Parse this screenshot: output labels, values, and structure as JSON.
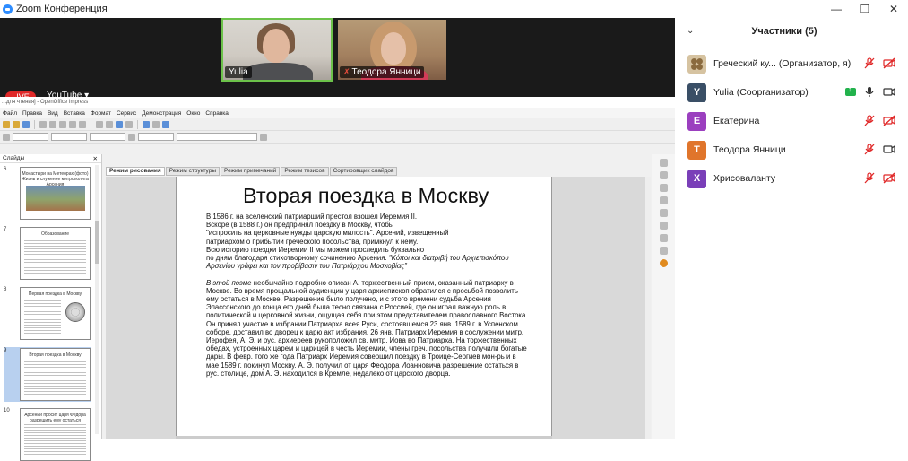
{
  "app": {
    "title": "Zoom Конференция"
  },
  "window_controls": {
    "minimize": "—",
    "restore": "❐",
    "close": "✕"
  },
  "videos": [
    {
      "name": "Yulia"
    },
    {
      "name": "Теодора Янници"
    }
  ],
  "stream": {
    "live_label": "LIVE",
    "platform_label": "YouTube"
  },
  "openoffice": {
    "title": "...для чтения] - OpenOffice Impress",
    "menu": [
      "Файл",
      "Правка",
      "Вид",
      "Вставка",
      "Формат",
      "Сервис",
      "Демонстрация",
      "Окно",
      "Справка"
    ],
    "slides_panel_label": "Слайды",
    "tabs": [
      "Режим рисования",
      "Режим структуры",
      "Режим примечаний",
      "Режим тезисов",
      "Сортировщик слайдов"
    ],
    "thumbnails": [
      {
        "num": "6",
        "title": "Монастыри на Метеорах (фото) Жизнь и служение митрополита Арсения"
      },
      {
        "num": "7",
        "title": "Образование"
      },
      {
        "num": "8",
        "title": "Первая поездка в Москву"
      },
      {
        "num": "9",
        "title": "Вторая поездка в Москву"
      },
      {
        "num": "10",
        "title": "Арсений просит царя Федора разрешить ему остаться"
      }
    ],
    "slide": {
      "title": "Вторая поездка в Москву",
      "para1": " В 1586 г. на вселенский патриарший престол взошел Иеремия II.\nВскоре (в 1588 г.) он предпринял поездку в Москву, чтобы\n\"испросить на церковные нужды царскую милость\". Арсений, извещенный\nпатриархом о прибытии греческого посольства, примкнул к нему.\nВсю историю поездки Иеремии II мы можем проследить буквально\nпо дням благодаря стихотворному сочинению Арсения.",
      "greek": " \"Κόποι και διατριβή του Αρχιεπισκόπου Αρσενίου γράφει και τον προβίβασιν του Πατριάρχου Μοσκοβίας\"",
      "para2_italic": " В этой поэме",
      "para2": " необычайно подробно описан А. торжественный прием, оказанный патриарху в Москве. Во время прощальной аудиенции у царя архиепископ обратился с просьбой позволить ему остаться в Москве. Разрешение было получено, и с этого времени судьба Арсения Элассонского до конца его дней была тесно связана с Россией, где он играл важную роль в политической и церковной жизни, ощущая себя при этом представителем православного Востока.\nОн принял участие в избрании Патриарха всея Руси, состоявшемся 23 янв. 1589 г. в Успенском соборе, доставил во дворец к царю акт избрания. 26 янв. Патриарх Иеремия в сослужении митр. Иерофея, А. Э. и рус. архиереев рукоположил св. митр. Иова во Патриарха. На торжественных обедах, устроенных царем и царицей в честь Иеремии, члены греч. посольства получили богатые дары. В февр. того же года Патриарх Иеремия совершил поездку в Троице-Сергиев мон-рь и в мае 1589 г. покинул Москву. А. Э. получил от царя Феодора Иоанновича разрешение остаться в рус. столице, дом А. Э. находился в Кремле, недалеко от царского дворца."
    }
  },
  "participants": {
    "header": "Участники (5)",
    "list": [
      {
        "initial": "",
        "name": "Греческий ку...",
        "role": "(Организатор, я)",
        "color": "#d6c3a1",
        "audio": "muted",
        "video": "off"
      },
      {
        "initial": "Y",
        "name": "Yulia",
        "role": "(Соорганизатор)",
        "color": "#3a4f66",
        "audio": "on",
        "video": "on",
        "sharing": true
      },
      {
        "initial": "E",
        "name": "Екатерина",
        "role": "",
        "color": "#9b3fbf",
        "audio": "muted",
        "video": "off"
      },
      {
        "initial": "T",
        "name": "Теодора Янници",
        "role": "",
        "color": "#e0752b",
        "audio": "muted",
        "video": "on"
      },
      {
        "initial": "X",
        "name": "Хрисоваланту",
        "role": "",
        "color": "#7a3fb8",
        "audio": "muted",
        "video": "off"
      }
    ]
  },
  "colors": {
    "accent": "#2d8cff",
    "active_speaker": "#6cc24a",
    "muted": "#e02828",
    "live": "#e02828"
  }
}
